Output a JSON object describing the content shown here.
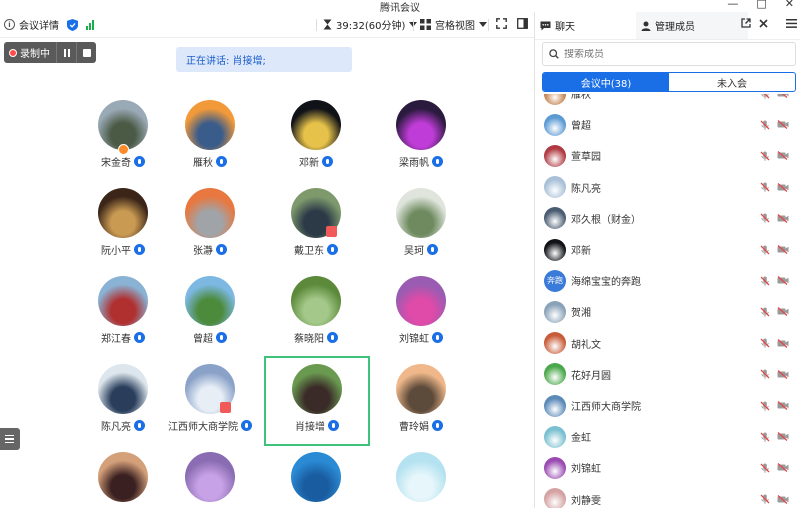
{
  "window": {
    "title": "腾讯会议",
    "controls": [
      "—",
      "□",
      "✕"
    ]
  },
  "toolbar": {
    "meeting_info": "会议详情",
    "timer": "39:32(60分钟)",
    "view": "宫格视图"
  },
  "recording": {
    "label": "录制中"
  },
  "speaking": {
    "text": "正在讲话: 肖接增;"
  },
  "grid": [
    {
      "name": "宋金奇",
      "bg": "#9aa9b6",
      "fg": "#4a5a44",
      "badge": "orange"
    },
    {
      "name": "雁秋",
      "bg": "#f29a3a",
      "fg": "#3a5c8a",
      "badge": ""
    },
    {
      "name": "邓新",
      "bg": "#101218",
      "fg": "#e6c24a",
      "badge": ""
    },
    {
      "name": "梁雨帆",
      "bg": "#2a1a3e",
      "fg": "#c03cd8",
      "badge": ""
    },
    {
      "name": "阮小平",
      "bg": "#3a2518",
      "fg": "#c99a52",
      "badge": ""
    },
    {
      "name": "张瀞",
      "bg": "#e87840",
      "fg": "#a0a4a8",
      "badge": ""
    },
    {
      "name": "戴卫东",
      "bg": "#7e9a6c",
      "fg": "#2c3a48",
      "badge": "red"
    },
    {
      "name": "吴珂",
      "bg": "#dfe5dd",
      "fg": "#6e8a5e",
      "badge": ""
    },
    {
      "name": "郑江春",
      "bg": "#8ab2d4",
      "fg": "#b03030",
      "badge": ""
    },
    {
      "name": "曾超",
      "bg": "#7cb8e2",
      "fg": "#4c8a3c",
      "badge": ""
    },
    {
      "name": "蔡晓阳",
      "bg": "#5c8a3a",
      "fg": "#a4c88a",
      "badge": ""
    },
    {
      "name": "刘锦虹",
      "bg": "#9a5cb2",
      "fg": "#e04aa8",
      "badge": ""
    },
    {
      "name": "陈凡亮",
      "bg": "#dce6ec",
      "fg": "#2a3e5c",
      "badge": ""
    },
    {
      "name": "江西师大商学院",
      "bg": "#8aa2c8",
      "fg": "#e8eef6",
      "badge": "red"
    },
    {
      "name": "肖接增",
      "bg": "#6a9a50",
      "fg": "#3a2a28",
      "badge": "",
      "active": true
    },
    {
      "name": "曹玲娟",
      "bg": "#f0b88a",
      "fg": "#5c4a3a",
      "badge": ""
    },
    {
      "name": "",
      "bg": "#d4a07a",
      "fg": "#3a2020",
      "badge": ""
    },
    {
      "name": "",
      "bg": "#8a6cb2",
      "fg": "#c8a2e6",
      "badge": ""
    },
    {
      "name": "",
      "bg": "#2a8ad4",
      "fg": "#1a5ca0",
      "badge": ""
    },
    {
      "name": "",
      "bg": "#b4e2f0",
      "fg": "#e6f6fa",
      "badge": ""
    }
  ],
  "panel": {
    "chat_tab": "聊天",
    "members_tab": "管理成员",
    "search_placeholder": "搜索成员",
    "in_meeting": "会议中(38)",
    "not_joined": "未入会",
    "members": [
      {
        "name": "雁秋",
        "bg": "#c07a42"
      },
      {
        "name": "曾超",
        "bg": "#5c9ad4"
      },
      {
        "name": "萱草园",
        "bg": "#b03a42"
      },
      {
        "name": "陈凡亮",
        "bg": "#a8c0d8"
      },
      {
        "name": "邓久根（财金）",
        "bg": "#4a5c72"
      },
      {
        "name": "邓新",
        "bg": "#101218"
      },
      {
        "name": "海绵宝宝的奔跑",
        "bg": "#3a7ad8",
        "text": "奔跑"
      },
      {
        "name": "贺湘",
        "bg": "#8aa2b8"
      },
      {
        "name": "胡礼文",
        "bg": "#c85c3a"
      },
      {
        "name": "花好月圆",
        "bg": "#4aa84a"
      },
      {
        "name": "江西师大商学院",
        "bg": "#5c8ab8"
      },
      {
        "name": "金虹",
        "bg": "#7ac0d0"
      },
      {
        "name": "刘锦虹",
        "bg": "#9a4ab2"
      },
      {
        "name": "刘静雯",
        "bg": "#d4a2a2"
      }
    ]
  }
}
